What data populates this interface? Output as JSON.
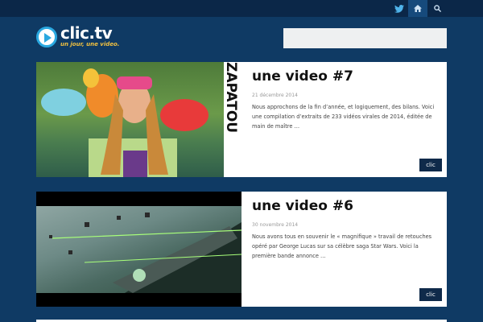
{
  "topbar": {
    "icons": [
      "twitter-icon",
      "home-icon",
      "search-icon"
    ]
  },
  "logo": {
    "name": "clic.tv",
    "tagline": "un jour, une video."
  },
  "search": {
    "placeholder": ""
  },
  "posts": [
    {
      "title": "une video #7",
      "date": "21 décembre 2014",
      "excerpt": "Nous approchons de la fin d’année, et logiquement, des bilans. Voici une compilation d’extraits de 233 vidéos virales de 2014, éditée de main de maître …",
      "thumb_text": "ZAPATOU",
      "button": "clic"
    },
    {
      "title": "une video #6",
      "date": "30 novembre 2014",
      "excerpt": "Nous avons tous en souvenir le « magnifique » travail de retouches opéré par George Lucas sur sa célèbre saga Star Wars. Voici la première bande annonce …",
      "button": "clic"
    }
  ],
  "colors": {
    "page_bg": "#0f3a64",
    "topbar_bg": "#0b2748",
    "button_bg": "#0f2a4a",
    "logo_accent": "#2aa8e0",
    "tagline": "#f0c040"
  }
}
